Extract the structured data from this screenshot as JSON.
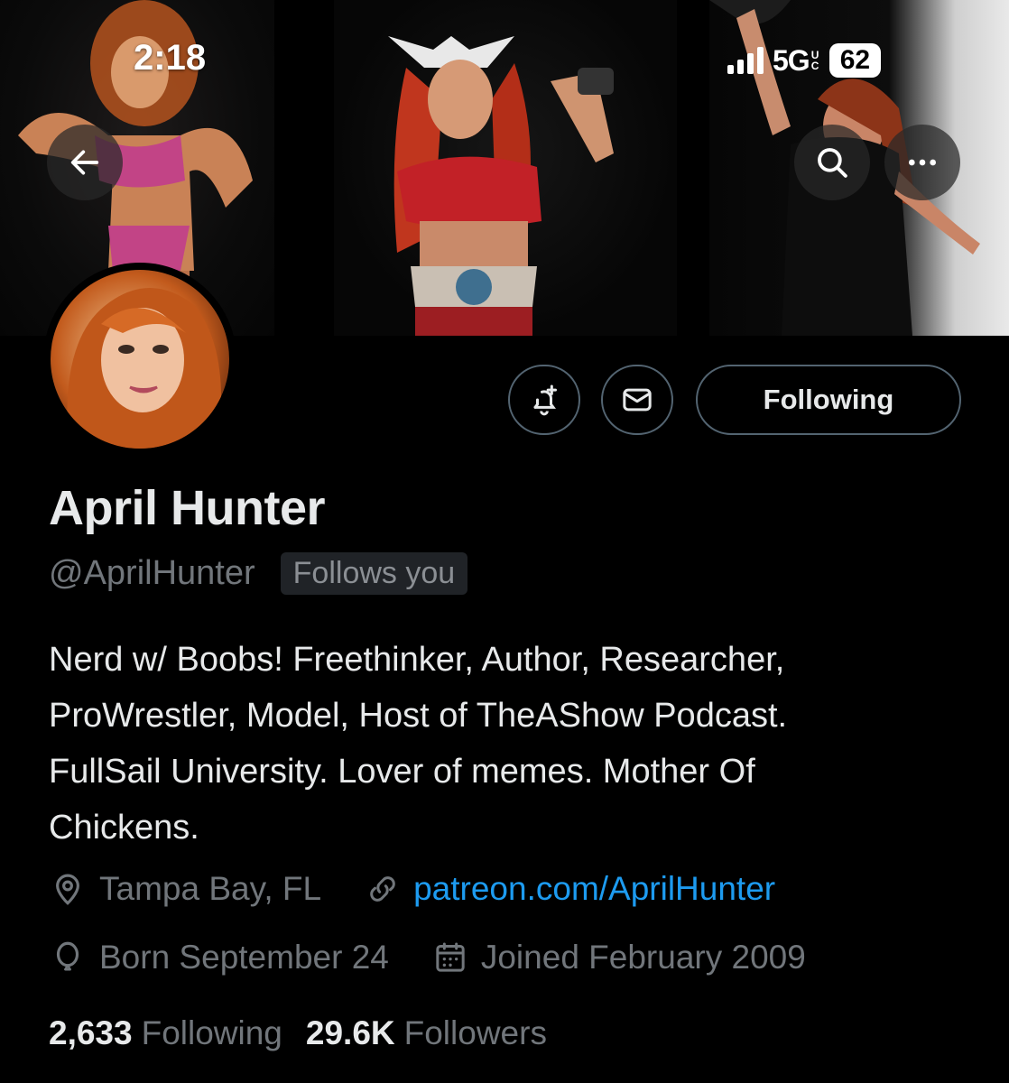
{
  "status_bar": {
    "time": "2:18",
    "network": "5G",
    "network_badge": "UC",
    "battery": "62"
  },
  "header": {
    "back_icon": "arrow-left-icon",
    "search_icon": "search-icon",
    "more_icon": "more-horizontal-icon"
  },
  "actions": {
    "notify_icon": "bell-plus-icon",
    "message_icon": "envelope-icon",
    "follow_label": "Following"
  },
  "profile": {
    "name": "April Hunter",
    "handle": "@AprilHunter",
    "follows_you": "Follows you",
    "bio_lines": [
      "Nerd w/ Boobs! Freethinker, Author, Researcher,",
      "ProWrestler, Model, Host of TheAShow Podcast.",
      "FullSail University. Lover of memes. Mother Of",
      "Chickens."
    ],
    "location": "Tampa Bay, FL",
    "website": "patreon.com/AprilHunter",
    "birthday": "Born September 24",
    "joined": "Joined February 2009",
    "following_count": "2,633",
    "following_label": "Following",
    "followers_count": "29.6K",
    "followers_label": "Followers"
  },
  "colors": {
    "background": "#000000",
    "text_primary": "#e7e9ea",
    "text_secondary": "#71767b",
    "link": "#1d9bf0",
    "button_border": "#536471"
  }
}
